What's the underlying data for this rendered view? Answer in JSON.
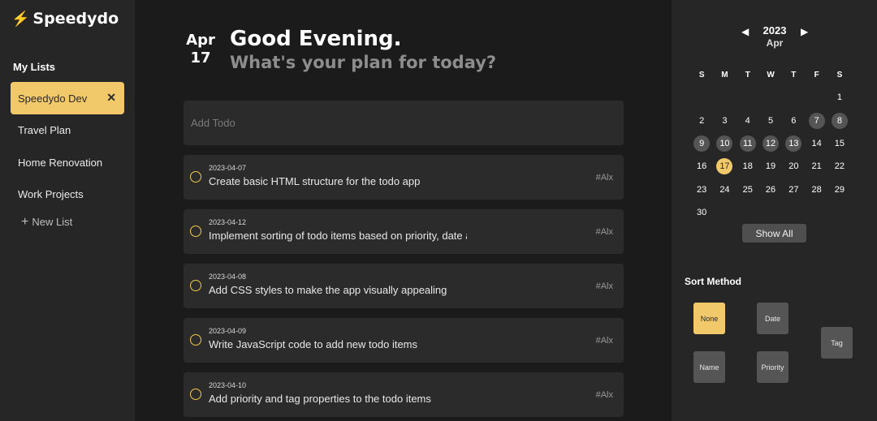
{
  "brand": {
    "icon": "lightning-icon",
    "glyph": "⚡",
    "title": "Speedydo"
  },
  "sidebar": {
    "section_label": "My Lists",
    "items": [
      {
        "label": "Speedydo Dev",
        "active": true
      },
      {
        "label": "Travel Plan"
      },
      {
        "label": "Home Renovation"
      },
      {
        "label": "Work Projects"
      }
    ],
    "close_glyph": "✕",
    "new_list": {
      "plus": "+",
      "label": "New List"
    }
  },
  "header": {
    "month": "Apr",
    "day": "17",
    "title": "Good Evening.",
    "subtitle": "What's your plan for today?"
  },
  "add_todo": {
    "placeholder": "Add Todo",
    "value": ""
  },
  "todos": [
    {
      "date": "2023-04-07",
      "text": "Create basic HTML structure for the todo app",
      "tag": "#Alx"
    },
    {
      "date": "2023-04-12",
      "text": "Implement sorting of todo items based on priority, date a",
      "tag": "#Alx"
    },
    {
      "date": "2023-04-08",
      "text": "Add CSS styles to make the app visually appealing",
      "tag": "#Alx"
    },
    {
      "date": "2023-04-09",
      "text": "Write JavaScript code to add new todo items",
      "tag": "#Alx"
    },
    {
      "date": "2023-04-10",
      "text": "Add priority and tag properties to the todo items",
      "tag": "#Alx"
    }
  ],
  "calendar": {
    "prev_glyph": "◀",
    "next_glyph": "▶",
    "year": "2023",
    "month": "Apr",
    "weekdays": [
      "S",
      "M",
      "T",
      "W",
      "T",
      "F",
      "S"
    ],
    "rows": [
      [
        "",
        "",
        "",
        "",
        "",
        "",
        "1"
      ],
      [
        "2",
        "3",
        "4",
        "5",
        "6",
        "7",
        "8"
      ],
      [
        "9",
        "10",
        "11",
        "12",
        "13",
        "14",
        "15"
      ],
      [
        "16",
        "17",
        "18",
        "19",
        "20",
        "21",
        "22"
      ],
      [
        "23",
        "24",
        "25",
        "26",
        "27",
        "28",
        "29"
      ],
      [
        "30",
        "",
        "",
        "",
        "",
        "",
        ""
      ]
    ],
    "highlighted_days": [
      "7",
      "8",
      "9",
      "10",
      "11",
      "12",
      "13"
    ],
    "today": "17",
    "show_all_label": "Show All"
  },
  "sort": {
    "label": "Sort Method",
    "options": {
      "none": "None",
      "date": "Date",
      "tag": "Tag",
      "name": "Name",
      "priority": "Priority"
    },
    "selected": "None"
  },
  "colors": {
    "accent": "#f2c96a",
    "background": "#1b1b1b",
    "panel": "#262626",
    "card": "#2b2b2b",
    "highlight_day": "#555555"
  }
}
